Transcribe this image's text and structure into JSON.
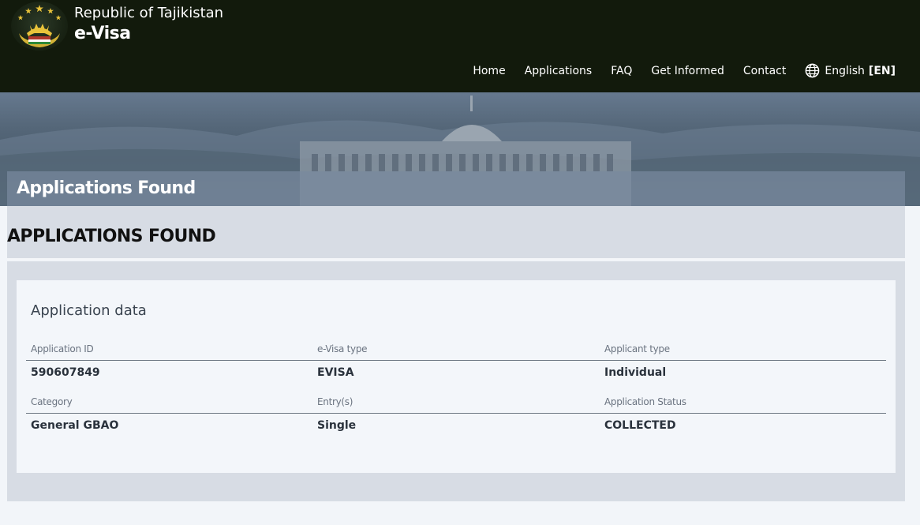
{
  "header": {
    "country": "Republic of Tajikistan",
    "title": "e-Visa",
    "nav": [
      {
        "label": "Home"
      },
      {
        "label": "Applications"
      },
      {
        "label": "FAQ"
      },
      {
        "label": "Get Informed"
      },
      {
        "label": "Contact"
      }
    ],
    "language": {
      "label": "English",
      "code": "[EN]",
      "icon": "globe-icon"
    }
  },
  "hero": {
    "banner_title": "Applications Found"
  },
  "section": {
    "title": "APPLICATIONS FOUND"
  },
  "card": {
    "title": "Application data",
    "rows": [
      {
        "fields": [
          {
            "label": "Application ID",
            "value": "590607849"
          },
          {
            "label": "e-Visa type",
            "value": "EVISA"
          },
          {
            "label": "Applicant type",
            "value": "Individual"
          }
        ]
      },
      {
        "fields": [
          {
            "label": "Category",
            "value": "General GBAO"
          },
          {
            "label": "Entry(s)",
            "value": "Single"
          },
          {
            "label": "Application Status",
            "value": "COLLECTED"
          }
        ]
      }
    ]
  },
  "colors": {
    "header_bg": "#121a0c",
    "page_bg": "#f2f5f9",
    "panel_bg": "#d7dce4",
    "card_bg": "#f3f6fa"
  }
}
